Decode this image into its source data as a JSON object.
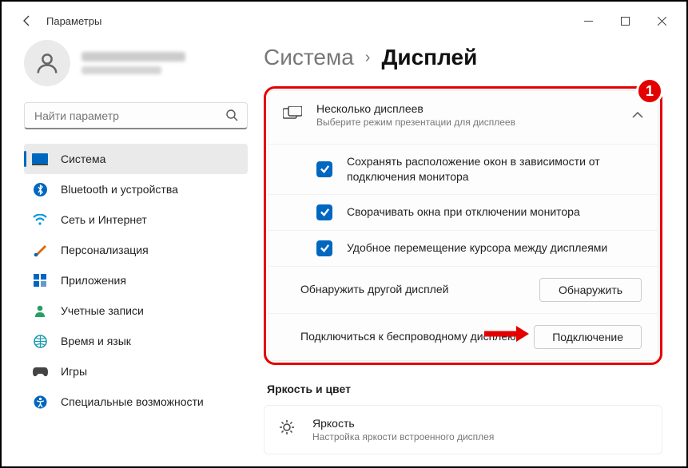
{
  "window": {
    "title": "Параметры"
  },
  "search": {
    "placeholder": "Найти параметр"
  },
  "nav": [
    {
      "label": "Система"
    },
    {
      "label": "Bluetooth и устройства"
    },
    {
      "label": "Сеть и Интернет"
    },
    {
      "label": "Персонализация"
    },
    {
      "label": "Приложения"
    },
    {
      "label": "Учетные записи"
    },
    {
      "label": "Время и язык"
    },
    {
      "label": "Игры"
    },
    {
      "label": "Специальные возможности"
    }
  ],
  "breadcrumb": {
    "parent": "Система",
    "current": "Дисплей"
  },
  "multi": {
    "title": "Несколько дисплеев",
    "subtitle": "Выберите режим презентации для дисплеев",
    "opt1": "Сохранять расположение окон в зависимости от подключения монитора",
    "opt2": "Сворачивать окна при отключении монитора",
    "opt3": "Удобное перемещение курсора между дисплеями",
    "detect_label": "Обнаружить другой дисплей",
    "detect_btn": "Обнаружить",
    "wireless_label": "Подключиться к беспроводному дисплею",
    "wireless_btn": "Подключение"
  },
  "brightness": {
    "section": "Яркость и цвет",
    "title": "Яркость",
    "subtitle": "Настройка яркости встроенного дисплея"
  },
  "badge": "1"
}
